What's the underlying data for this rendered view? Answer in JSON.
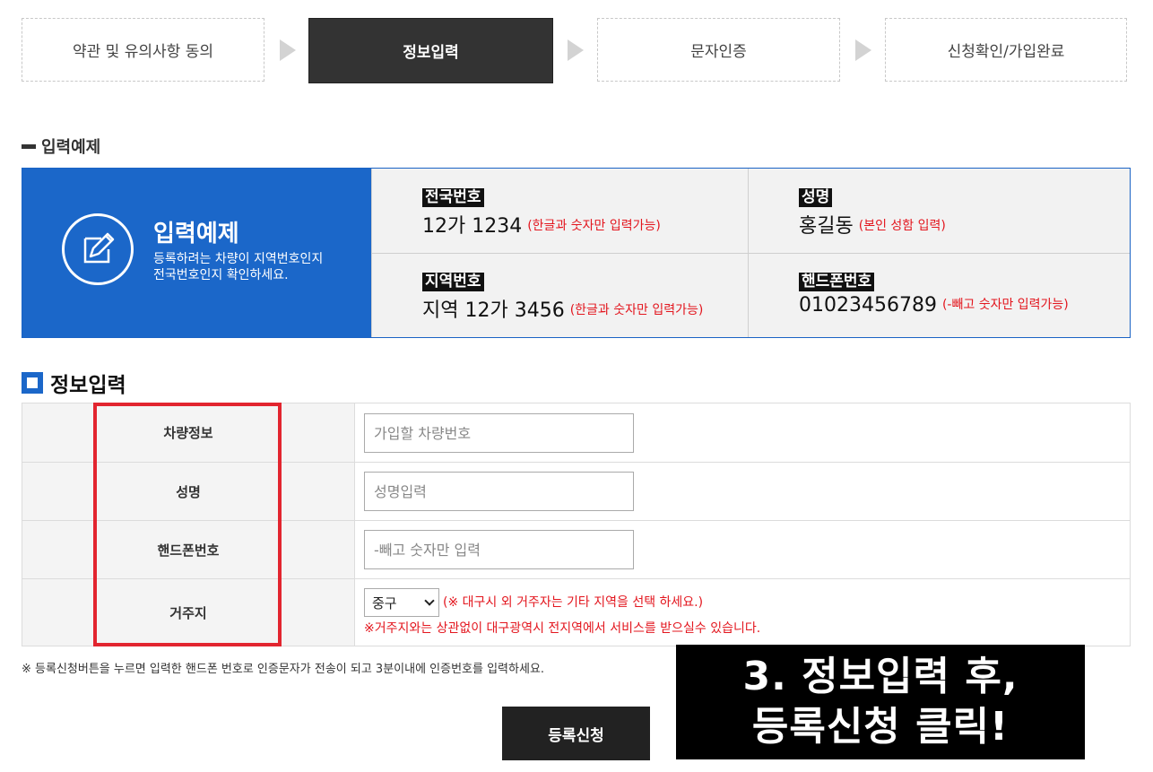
{
  "steps": [
    {
      "label": "약관 및 유의사항 동의"
    },
    {
      "label": "정보입력"
    },
    {
      "label": "문자인증"
    },
    {
      "label": "신청확인/가입완료"
    }
  ],
  "example_section": {
    "label": "입력예제",
    "title": "입력예제",
    "desc_line1": "등록하려는 차량이 지역번호인지",
    "desc_line2": "전국번호인지 확인하세요.",
    "cells": [
      {
        "tag": "전국번호",
        "value": "12가 1234",
        "note": "(한글과 숫자만 입력가능)"
      },
      {
        "tag": "성명",
        "value": "홍길동",
        "note": "(본인 성함 입력)"
      },
      {
        "tag": "지역번호",
        "value": "지역 12가 3456",
        "note": "(한글과 숫자만 입력가능)"
      },
      {
        "tag": "핸드폰번호",
        "value": "01023456789",
        "note": "(-빼고 숫자만 입력가능)"
      }
    ]
  },
  "form": {
    "title": "정보입력",
    "rows": [
      {
        "label": "차량정보",
        "placeholder": "가입할 차량번호"
      },
      {
        "label": "성명",
        "placeholder": "성명입력"
      },
      {
        "label": "핸드폰번호",
        "placeholder": "-빼고 숫자만 입력"
      }
    ],
    "residence": {
      "label": "거주지",
      "selected": "중구",
      "note1": "(※ 대구시 외 거주자는 기타 지역을 선택 하세요.)",
      "note2": "※거주지와는 상관없이 대구광역시 전지역에서 서비스를 받으실수 있습니다."
    }
  },
  "bottom_note": "※ 등록신청버튼을 누르면 입력한 핸드폰 번호로 인증문자가 전송이 되고 3분이내에 인증번호를 입력하세요.",
  "submit_label": "등록신청",
  "caption_line1": "3. 정보입력 후,",
  "caption_line2": "등록신청 클릭!",
  "colors": {
    "blue": "#1b67c9",
    "red": "#e3161e",
    "highlight": "#e2252f",
    "dark": "#333333"
  }
}
